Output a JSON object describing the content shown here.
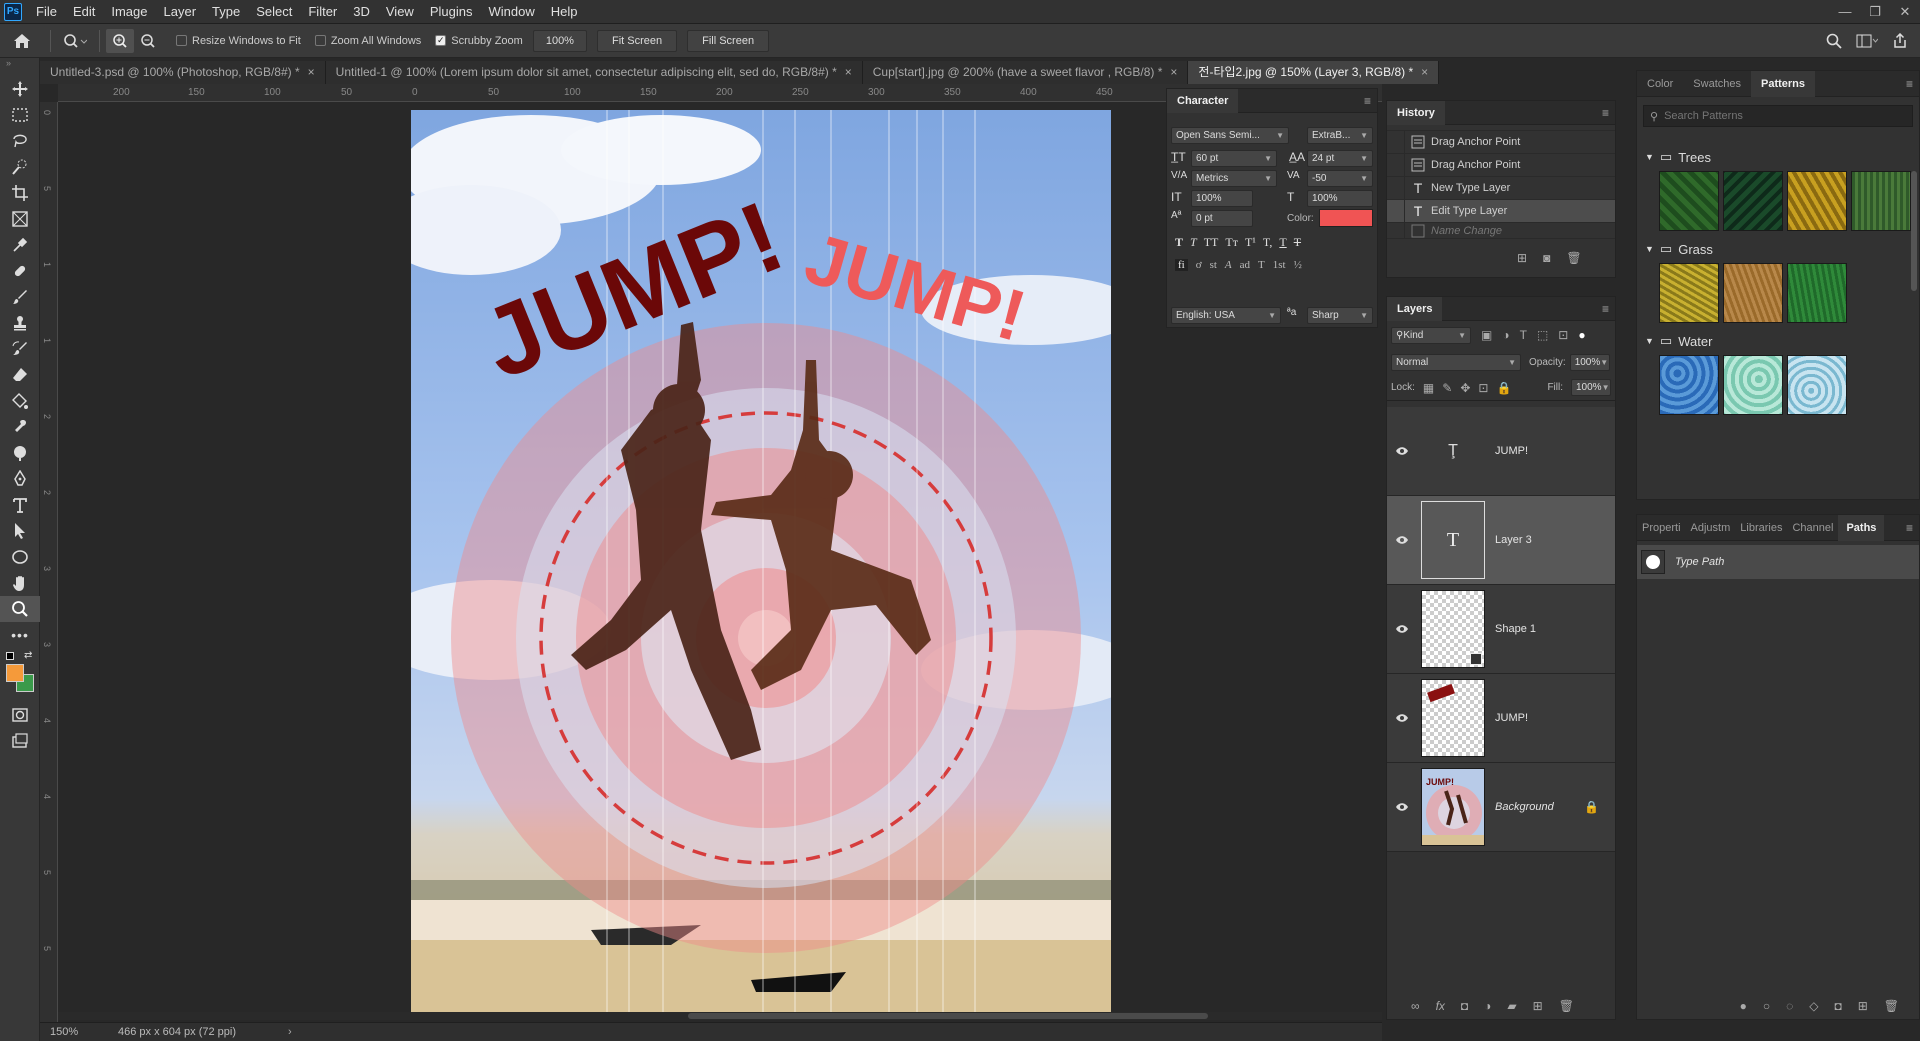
{
  "app": {
    "logo": "Ps"
  },
  "menu": [
    "File",
    "Edit",
    "Image",
    "Layer",
    "Type",
    "Select",
    "Filter",
    "3D",
    "View",
    "Plugins",
    "Window",
    "Help"
  ],
  "window_controls": {
    "minimize": "—",
    "restore": "❐",
    "close": "✕"
  },
  "options_bar": {
    "resize_windows": "Resize Windows to Fit",
    "zoom_all": "Zoom All Windows",
    "scrubby_zoom": "Scrubby Zoom",
    "zoom_value": "100%",
    "fit_screen": "Fit Screen",
    "fill_screen": "Fill Screen"
  },
  "doc_tabs": [
    {
      "label": "Untitled-3.psd @ 100% (Photoshop, RGB/8#) *"
    },
    {
      "label": "Untitled-1 @ 100% (Lorem ipsum dolor sit amet, consectetur adipiscing elit, sed do, RGB/8#) *"
    },
    {
      "label": "Cup[start].jpg @ 200% (have a sweet flavor , RGB/8) *"
    },
    {
      "label": "전-타입2.jpg @ 150% (Layer 3, RGB/8) *"
    }
  ],
  "ruler_top": [
    "200",
    "150",
    "100",
    "50",
    "0",
    "50",
    "100",
    "150",
    "200",
    "250",
    "300",
    "350",
    "400",
    "450"
  ],
  "ruler_left": [
    "0",
    "5",
    "1",
    "1",
    "2",
    "2",
    "3",
    "3",
    "4",
    "4",
    "5",
    "5",
    "6",
    "6"
  ],
  "artwork": {
    "jump_dark": "JUMP!",
    "jump_red": "JUMP!"
  },
  "character_panel": {
    "title": "Character",
    "font_family": "Open Sans Semi...",
    "font_style": "ExtraB...",
    "size": "60 pt",
    "leading": "24 pt",
    "kerning": "Metrics",
    "tracking": "-50",
    "vscale": "100%",
    "hscale": "100%",
    "baseline": "0 pt",
    "color_label": "Color:",
    "color": "#f05454",
    "language": "English: USA",
    "aa_icon": "ªa",
    "antialias": "Sharp",
    "style_buttons": [
      "T",
      "T",
      "TT",
      "Tт",
      "T¹",
      "T,",
      "T",
      "T"
    ],
    "opentype_buttons": [
      "fi",
      "ơ",
      "st",
      "A",
      "ad",
      "T",
      "1st",
      "½"
    ]
  },
  "history_panel": {
    "title": "History",
    "rows": [
      {
        "label": "Drag Anchor Point",
        "icon": "doc"
      },
      {
        "label": "Drag Anchor Point",
        "icon": "doc"
      },
      {
        "label": "New Type Layer",
        "icon": "type"
      },
      {
        "label": "Edit Type Layer",
        "icon": "type",
        "selected": true
      },
      {
        "label": "Name Change",
        "icon": "doc",
        "dim": true
      }
    ]
  },
  "layers_panel": {
    "title": "Layers",
    "filter_kind": "Kind",
    "blend_mode": "Normal",
    "opacity_label": "Opacity:",
    "opacity": "100%",
    "lock_label": "Lock:",
    "fill_label": "Fill:",
    "fill": "100%",
    "layers": [
      {
        "name": "JUMP!",
        "kind": "type-warp",
        "selected": false
      },
      {
        "name": "Layer 3",
        "kind": "type",
        "selected": true
      },
      {
        "name": "Shape 1",
        "kind": "shape",
        "selected": false
      },
      {
        "name": "JUMP!",
        "kind": "raster",
        "selected": false
      },
      {
        "name": "Background",
        "kind": "photo",
        "locked": true,
        "italic": true
      }
    ],
    "bottom_icons": [
      "∞",
      "fx"
    ]
  },
  "patterns_panel": {
    "tabs": [
      "Color",
      "Swatches",
      "Patterns"
    ],
    "active_tab": "Patterns",
    "search_placeholder": "Search Patterns",
    "groups": [
      {
        "name": "Trees",
        "colors": [
          "#1e4d1e",
          "#0e2a1a",
          "#8a6a10",
          "#2f5a2a"
        ]
      },
      {
        "name": "Grass",
        "colors": [
          "#8a7a1a",
          "#9a6a2a",
          "#1f6a2a"
        ]
      },
      {
        "name": "Water",
        "colors": [
          "#2a6ab8",
          "#7ac8b0",
          "#7ab8d0"
        ]
      }
    ]
  },
  "paths_panel": {
    "tabs": [
      "Properti",
      "Adjustm",
      "Libraries",
      "Channel",
      "Paths"
    ],
    "active_tab": "Paths",
    "rows": [
      {
        "label": "Type Path"
      }
    ]
  },
  "status": {
    "zoom": "150%",
    "doc_size": "466 px x 604 px (72 ppi)",
    "arrow": "›"
  }
}
